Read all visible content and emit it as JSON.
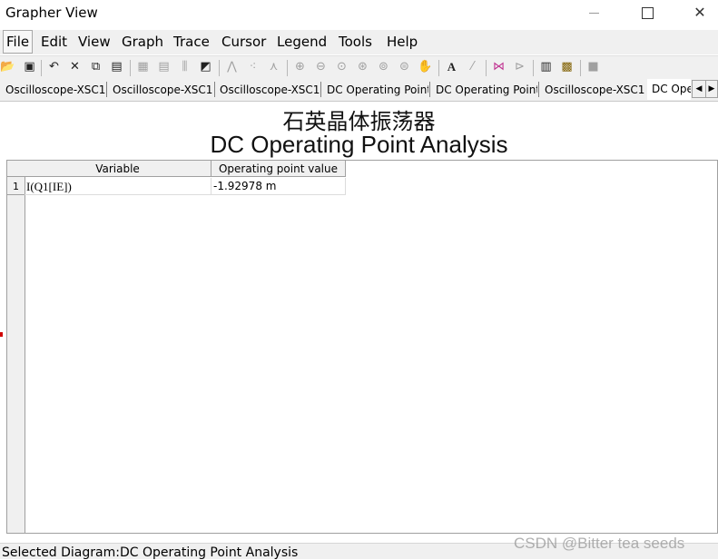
{
  "window": {
    "title": "Grapher View"
  },
  "menu": [
    "File",
    "Edit",
    "View",
    "Graph",
    "Trace",
    "Cursor",
    "Legend",
    "Tools",
    "Help"
  ],
  "tabs": [
    "Oscilloscope-XSC1",
    "Oscilloscope-XSC1",
    "Oscilloscope-XSC1",
    "DC Operating Point",
    "DC Operating Point",
    "Oscilloscope-XSC1",
    "DC Ope"
  ],
  "diagram": {
    "title_cn": "石英晶体振荡器",
    "title_en": "DC Operating Point Analysis",
    "columns": [
      "Variable",
      "Operating point value"
    ],
    "rows": [
      {
        "num": "1",
        "variable": "I(Q1[IE])",
        "value": "-1.92978 m"
      }
    ]
  },
  "status": {
    "text": "Selected Diagram:DC Operating Point Analysis"
  },
  "watermark": "CSDN @Bitter tea seeds"
}
